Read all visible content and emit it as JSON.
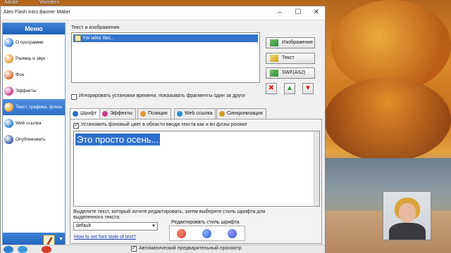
{
  "desktop": {
    "icons": [
      {
        "label": "Adobe"
      },
      {
        "label": "Wonders"
      }
    ]
  },
  "window": {
    "title": "Aleo Flash Intro Banner Maker"
  },
  "menu": {
    "header": "Меню",
    "items": [
      {
        "label": "О программе",
        "icon": "info-icon",
        "color": "#2f7fe0"
      },
      {
        "label": "Размер и звук",
        "icon": "speaker-icon",
        "color": "#e09a30"
      },
      {
        "label": "Фон",
        "icon": "palette-icon",
        "color": "#d26a2a"
      },
      {
        "label": "Эффекты",
        "icon": "sparkle-icon",
        "color": "#c83a8c"
      },
      {
        "label": "Текст, графика, флеш",
        "icon": "brush-icon",
        "color": "#f0a030",
        "active": true
      },
      {
        "label": "Web ссылка",
        "icon": "globe-icon",
        "color": "#2a7fd0"
      },
      {
        "label": "Опубликовать",
        "icon": "publish-icon",
        "color": "#3b5ea8"
      }
    ]
  },
  "main": {
    "texts_label": "Текст и изображения",
    "list_item": "Yöi ialïoi ïlaü...",
    "buttons": {
      "image": "Изображение",
      "text": "Текст",
      "swf": "SWF(AS2)"
    },
    "ignore_time_label": "Игнорировать установки времени, показывать фрагменты один за други",
    "tabs": [
      {
        "label": "Шрифт",
        "icon_color": "#2e6bc7",
        "active": true
      },
      {
        "label": "Эффекты",
        "icon_color": "#c83a8c"
      },
      {
        "label": "Позиция",
        "icon_color": "#e09a30"
      },
      {
        "label": "Web ссылка",
        "icon_color": "#2a8fd0"
      },
      {
        "label": "Синхронизация",
        "icon_color": "#d4a020"
      }
    ],
    "bg_color_label": "Установить фоновый цвет в области ввода текста как и во флэш ролике",
    "editor_text": "Это просто осень...",
    "hint_text_1": "Выделите текст, который хотите редактировать, затем выберите стиль шрифта для",
    "hint_text_2": "выделенного текста:",
    "font_style_select": "default",
    "font_style_link": "How to set font style of text?",
    "edit_style_label": "Редактировать стиль шрифта",
    "style_colors": [
      "#d23a2a",
      "#2a5fc8",
      "#3a4fc0"
    ]
  },
  "footer": {
    "auto_preview_label": "Автоматический предварительный просмотр"
  },
  "accent": "#2f6fd0"
}
